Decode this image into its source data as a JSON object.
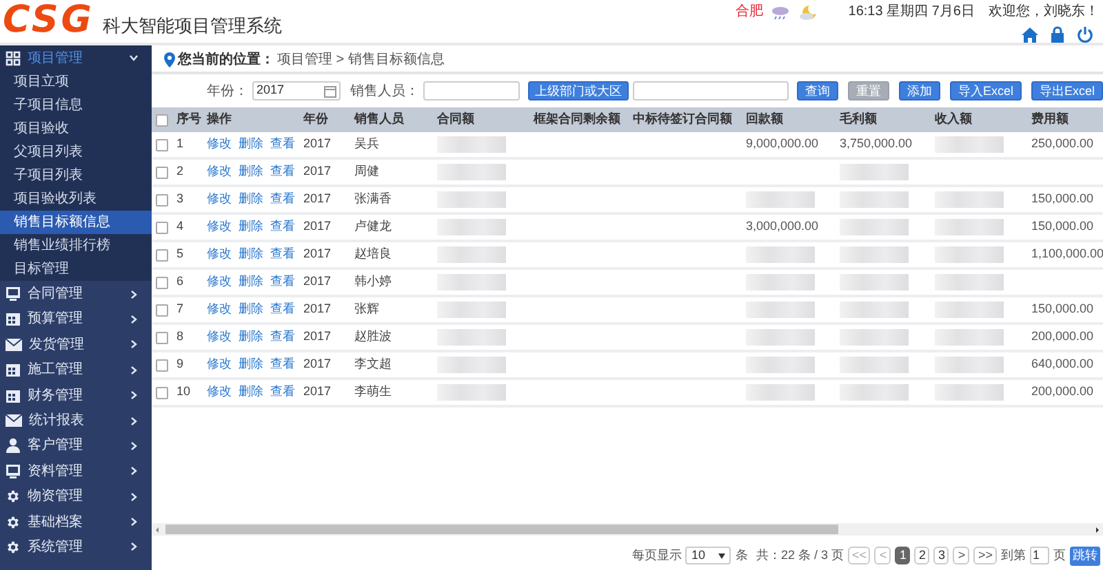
{
  "header": {
    "logo": "CSG",
    "title": "科大智能项目管理系统",
    "city": "合肥",
    "datetime": "16:13 星期四 7月6日",
    "welcome": "欢迎您，刘晓东！"
  },
  "sidebar": {
    "items": [
      {
        "label": "项目管理",
        "kind": "grid",
        "expanded": true,
        "children": [
          {
            "label": "项目立项",
            "selected": false
          },
          {
            "label": "子项目信息",
            "selected": false
          },
          {
            "label": "项目验收",
            "selected": false
          },
          {
            "label": "父项目列表",
            "selected": false
          },
          {
            "label": "子项目列表",
            "selected": false
          },
          {
            "label": "项目验收列表",
            "selected": false
          },
          {
            "label": "销售目标额信息",
            "selected": true
          },
          {
            "label": "销售业绩排行榜",
            "selected": false
          },
          {
            "label": "目标管理",
            "selected": false
          }
        ]
      },
      {
        "label": "合同管理",
        "kind": "monitor",
        "expanded": false
      },
      {
        "label": "预算管理",
        "kind": "calendar",
        "expanded": false
      },
      {
        "label": "发货管理",
        "kind": "mail",
        "expanded": false
      },
      {
        "label": "施工管理",
        "kind": "calendar",
        "expanded": false
      },
      {
        "label": "财务管理",
        "kind": "calendar",
        "expanded": false
      },
      {
        "label": "统计报表",
        "kind": "mail",
        "expanded": false
      },
      {
        "label": "客户管理",
        "kind": "user",
        "expanded": false
      },
      {
        "label": "资料管理",
        "kind": "monitor",
        "expanded": false
      },
      {
        "label": "物资管理",
        "kind": "gear",
        "expanded": false
      },
      {
        "label": "基础档案",
        "kind": "gear",
        "expanded": false
      },
      {
        "label": "系统管理",
        "kind": "gear",
        "expanded": false
      }
    ]
  },
  "breadcrumb": {
    "label": "您当前的位置：",
    "path": "项目管理 > 销售目标额信息"
  },
  "filters": {
    "year_label": "年份：",
    "year": "2017",
    "sales_label": "销售人员：",
    "dept_button": "上级部门或大区",
    "buttons": [
      {
        "label": "查询",
        "disabled": false
      },
      {
        "label": "重置",
        "disabled": true
      },
      {
        "label": "添加",
        "disabled": false
      },
      {
        "label": "导入Excel",
        "disabled": false
      },
      {
        "label": "导出Excel",
        "disabled": false
      }
    ]
  },
  "table": {
    "select_all_checked": false,
    "columns": [
      "序号",
      "操作",
      "年份",
      "销售人员",
      "合同额",
      "框架合同剩余额",
      "中标待签订合同额",
      "回款额",
      "毛利额",
      "收入额",
      "费用额"
    ],
    "rows": [
      {
        "no": "1",
        "actions": [
          "修改",
          "删除",
          "查看"
        ],
        "year": "2017",
        "person": "吴兵",
        "checked": false,
        "values": [
          {
            "kind": "blurred"
          },
          {
            "kind": "blank"
          },
          {
            "kind": "blank"
          },
          {
            "kind": "text",
            "text": "9,000,000.00"
          },
          {
            "kind": "text",
            "text": "3,750,000.00"
          },
          {
            "kind": "blurred"
          },
          {
            "kind": "text",
            "text": "250,000.00"
          }
        ]
      },
      {
        "no": "2",
        "actions": [
          "修改",
          "删除",
          "查看"
        ],
        "year": "2017",
        "person": "周健",
        "checked": false,
        "values": [
          {
            "kind": "blurred"
          },
          {
            "kind": "blank"
          },
          {
            "kind": "blank"
          },
          {
            "kind": "blank"
          },
          {
            "kind": "blurred"
          },
          {
            "kind": "blank"
          },
          {
            "kind": "blank"
          }
        ]
      },
      {
        "no": "3",
        "actions": [
          "修改",
          "删除",
          "查看"
        ],
        "year": "2017",
        "person": "张满香",
        "checked": false,
        "values": [
          {
            "kind": "blurred"
          },
          {
            "kind": "blank"
          },
          {
            "kind": "blank"
          },
          {
            "kind": "blurred"
          },
          {
            "kind": "blurred"
          },
          {
            "kind": "blurred"
          },
          {
            "kind": "text",
            "text": "150,000.00"
          }
        ]
      },
      {
        "no": "4",
        "actions": [
          "修改",
          "删除",
          "查看"
        ],
        "year": "2017",
        "person": "卢健龙",
        "checked": false,
        "values": [
          {
            "kind": "blurred"
          },
          {
            "kind": "blank"
          },
          {
            "kind": "blank"
          },
          {
            "kind": "text",
            "text": "3,000,000.00"
          },
          {
            "kind": "blurred"
          },
          {
            "kind": "blurred"
          },
          {
            "kind": "text",
            "text": "150,000.00"
          }
        ]
      },
      {
        "no": "5",
        "actions": [
          "修改",
          "删除",
          "查看"
        ],
        "year": "2017",
        "person": "赵培良",
        "checked": false,
        "values": [
          {
            "kind": "blurred"
          },
          {
            "kind": "blank"
          },
          {
            "kind": "blank"
          },
          {
            "kind": "blurred"
          },
          {
            "kind": "blurred"
          },
          {
            "kind": "blurred"
          },
          {
            "kind": "text",
            "text": "1,100,000.00"
          }
        ]
      },
      {
        "no": "6",
        "actions": [
          "修改",
          "删除",
          "查看"
        ],
        "year": "2017",
        "person": "韩小婷",
        "checked": false,
        "values": [
          {
            "kind": "blurred"
          },
          {
            "kind": "blank"
          },
          {
            "kind": "blank"
          },
          {
            "kind": "blurred"
          },
          {
            "kind": "blurred"
          },
          {
            "kind": "blurred"
          },
          {
            "kind": "blank"
          }
        ]
      },
      {
        "no": "7",
        "actions": [
          "修改",
          "删除",
          "查看"
        ],
        "year": "2017",
        "person": "张辉",
        "checked": false,
        "values": [
          {
            "kind": "blurred"
          },
          {
            "kind": "blank"
          },
          {
            "kind": "blank"
          },
          {
            "kind": "blurred"
          },
          {
            "kind": "blurred"
          },
          {
            "kind": "blurred"
          },
          {
            "kind": "text",
            "text": "150,000.00"
          }
        ]
      },
      {
        "no": "8",
        "actions": [
          "修改",
          "删除",
          "查看"
        ],
        "year": "2017",
        "person": "赵胜波",
        "checked": false,
        "values": [
          {
            "kind": "blurred"
          },
          {
            "kind": "blank"
          },
          {
            "kind": "blank"
          },
          {
            "kind": "blurred"
          },
          {
            "kind": "blurred"
          },
          {
            "kind": "blurred"
          },
          {
            "kind": "text",
            "text": "200,000.00"
          }
        ]
      },
      {
        "no": "9",
        "actions": [
          "修改",
          "删除",
          "查看"
        ],
        "year": "2017",
        "person": "李文超",
        "checked": false,
        "values": [
          {
            "kind": "blurred"
          },
          {
            "kind": "blank"
          },
          {
            "kind": "blank"
          },
          {
            "kind": "blurred"
          },
          {
            "kind": "blurred"
          },
          {
            "kind": "blurred"
          },
          {
            "kind": "text",
            "text": "640,000.00"
          }
        ]
      },
      {
        "no": "10",
        "actions": [
          "修改",
          "删除",
          "查看"
        ],
        "year": "2017",
        "person": "李萌生",
        "checked": false,
        "values": [
          {
            "kind": "blurred"
          },
          {
            "kind": "blank"
          },
          {
            "kind": "blank"
          },
          {
            "kind": "blurred"
          },
          {
            "kind": "blurred"
          },
          {
            "kind": "blurred"
          },
          {
            "kind": "text",
            "text": "200,000.00"
          }
        ]
      }
    ]
  },
  "pagination": {
    "per_page_label": "每页显示",
    "per_page": "10",
    "unit": "条",
    "total": "共：22 条 / 3 页",
    "first": "<<",
    "prev": "<",
    "pages": [
      {
        "label": "1",
        "selected": true
      },
      {
        "label": "2",
        "selected": false
      },
      {
        "label": "3",
        "selected": false
      }
    ],
    "next": ">",
    "last": ">>",
    "goto_label": "到第",
    "goto_value": "1",
    "page_unit": "页",
    "jump": "跳转"
  }
}
